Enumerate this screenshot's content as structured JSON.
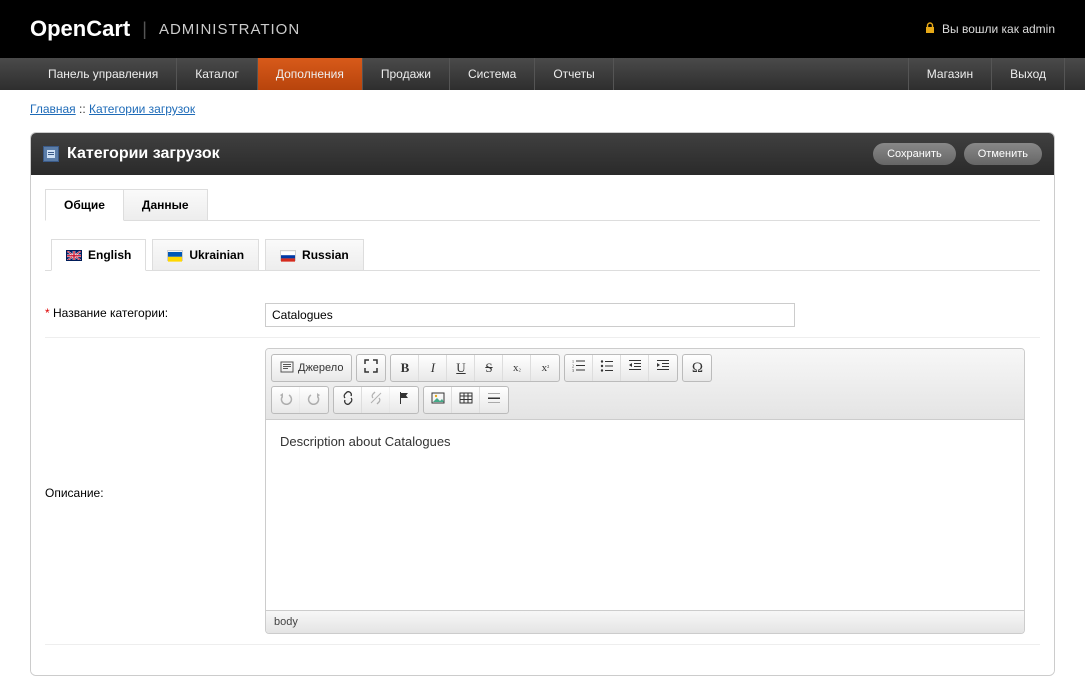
{
  "header": {
    "logo": "OpenCart",
    "admin_label": "ADMINISTRATION",
    "login_text": "Вы вошли как admin"
  },
  "nav": {
    "items": [
      {
        "label": "Панель управления"
      },
      {
        "label": "Каталог"
      },
      {
        "label": "Дополнения"
      },
      {
        "label": "Продажи"
      },
      {
        "label": "Система"
      },
      {
        "label": "Отчеты"
      }
    ],
    "right": [
      {
        "label": "Магазин"
      },
      {
        "label": "Выход"
      }
    ]
  },
  "breadcrumb": {
    "home": "Главная",
    "sep": "::",
    "current": "Категории загрузок"
  },
  "box": {
    "title": "Категории загрузок",
    "save": "Сохранить",
    "cancel": "Отменить"
  },
  "tabs": {
    "general": "Общие",
    "data": "Данные"
  },
  "langs": [
    {
      "label": "English"
    },
    {
      "label": "Ukrainian"
    },
    {
      "label": "Russian"
    }
  ],
  "form": {
    "name_label": "Название категории:",
    "name_value": "Catalogues",
    "desc_label": "Описание:",
    "desc_value": "Description about Catalogues"
  },
  "editor": {
    "source": "Джерело",
    "footer": "body"
  }
}
